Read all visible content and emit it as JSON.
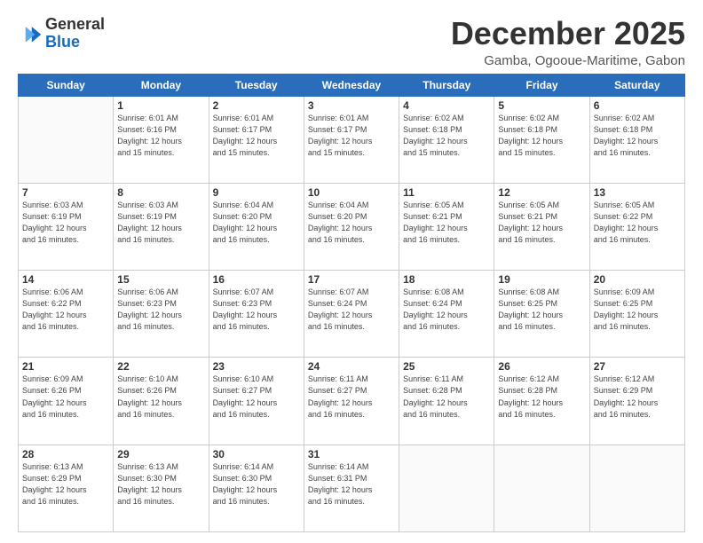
{
  "header": {
    "logo_general": "General",
    "logo_blue": "Blue",
    "title": "December 2025",
    "location": "Gamba, Ogooue-Maritime, Gabon"
  },
  "calendar": {
    "days_of_week": [
      "Sunday",
      "Monday",
      "Tuesday",
      "Wednesday",
      "Thursday",
      "Friday",
      "Saturday"
    ],
    "weeks": [
      [
        {
          "day": "",
          "info": ""
        },
        {
          "day": "1",
          "info": "Sunrise: 6:01 AM\nSunset: 6:16 PM\nDaylight: 12 hours\nand 15 minutes."
        },
        {
          "day": "2",
          "info": "Sunrise: 6:01 AM\nSunset: 6:17 PM\nDaylight: 12 hours\nand 15 minutes."
        },
        {
          "day": "3",
          "info": "Sunrise: 6:01 AM\nSunset: 6:17 PM\nDaylight: 12 hours\nand 15 minutes."
        },
        {
          "day": "4",
          "info": "Sunrise: 6:02 AM\nSunset: 6:18 PM\nDaylight: 12 hours\nand 15 minutes."
        },
        {
          "day": "5",
          "info": "Sunrise: 6:02 AM\nSunset: 6:18 PM\nDaylight: 12 hours\nand 15 minutes."
        },
        {
          "day": "6",
          "info": "Sunrise: 6:02 AM\nSunset: 6:18 PM\nDaylight: 12 hours\nand 16 minutes."
        }
      ],
      [
        {
          "day": "7",
          "info": "Sunrise: 6:03 AM\nSunset: 6:19 PM\nDaylight: 12 hours\nand 16 minutes."
        },
        {
          "day": "8",
          "info": "Sunrise: 6:03 AM\nSunset: 6:19 PM\nDaylight: 12 hours\nand 16 minutes."
        },
        {
          "day": "9",
          "info": "Sunrise: 6:04 AM\nSunset: 6:20 PM\nDaylight: 12 hours\nand 16 minutes."
        },
        {
          "day": "10",
          "info": "Sunrise: 6:04 AM\nSunset: 6:20 PM\nDaylight: 12 hours\nand 16 minutes."
        },
        {
          "day": "11",
          "info": "Sunrise: 6:05 AM\nSunset: 6:21 PM\nDaylight: 12 hours\nand 16 minutes."
        },
        {
          "day": "12",
          "info": "Sunrise: 6:05 AM\nSunset: 6:21 PM\nDaylight: 12 hours\nand 16 minutes."
        },
        {
          "day": "13",
          "info": "Sunrise: 6:05 AM\nSunset: 6:22 PM\nDaylight: 12 hours\nand 16 minutes."
        }
      ],
      [
        {
          "day": "14",
          "info": "Sunrise: 6:06 AM\nSunset: 6:22 PM\nDaylight: 12 hours\nand 16 minutes."
        },
        {
          "day": "15",
          "info": "Sunrise: 6:06 AM\nSunset: 6:23 PM\nDaylight: 12 hours\nand 16 minutes."
        },
        {
          "day": "16",
          "info": "Sunrise: 6:07 AM\nSunset: 6:23 PM\nDaylight: 12 hours\nand 16 minutes."
        },
        {
          "day": "17",
          "info": "Sunrise: 6:07 AM\nSunset: 6:24 PM\nDaylight: 12 hours\nand 16 minutes."
        },
        {
          "day": "18",
          "info": "Sunrise: 6:08 AM\nSunset: 6:24 PM\nDaylight: 12 hours\nand 16 minutes."
        },
        {
          "day": "19",
          "info": "Sunrise: 6:08 AM\nSunset: 6:25 PM\nDaylight: 12 hours\nand 16 minutes."
        },
        {
          "day": "20",
          "info": "Sunrise: 6:09 AM\nSunset: 6:25 PM\nDaylight: 12 hours\nand 16 minutes."
        }
      ],
      [
        {
          "day": "21",
          "info": "Sunrise: 6:09 AM\nSunset: 6:26 PM\nDaylight: 12 hours\nand 16 minutes."
        },
        {
          "day": "22",
          "info": "Sunrise: 6:10 AM\nSunset: 6:26 PM\nDaylight: 12 hours\nand 16 minutes."
        },
        {
          "day": "23",
          "info": "Sunrise: 6:10 AM\nSunset: 6:27 PM\nDaylight: 12 hours\nand 16 minutes."
        },
        {
          "day": "24",
          "info": "Sunrise: 6:11 AM\nSunset: 6:27 PM\nDaylight: 12 hours\nand 16 minutes."
        },
        {
          "day": "25",
          "info": "Sunrise: 6:11 AM\nSunset: 6:28 PM\nDaylight: 12 hours\nand 16 minutes."
        },
        {
          "day": "26",
          "info": "Sunrise: 6:12 AM\nSunset: 6:28 PM\nDaylight: 12 hours\nand 16 minutes."
        },
        {
          "day": "27",
          "info": "Sunrise: 6:12 AM\nSunset: 6:29 PM\nDaylight: 12 hours\nand 16 minutes."
        }
      ],
      [
        {
          "day": "28",
          "info": "Sunrise: 6:13 AM\nSunset: 6:29 PM\nDaylight: 12 hours\nand 16 minutes."
        },
        {
          "day": "29",
          "info": "Sunrise: 6:13 AM\nSunset: 6:30 PM\nDaylight: 12 hours\nand 16 minutes."
        },
        {
          "day": "30",
          "info": "Sunrise: 6:14 AM\nSunset: 6:30 PM\nDaylight: 12 hours\nand 16 minutes."
        },
        {
          "day": "31",
          "info": "Sunrise: 6:14 AM\nSunset: 6:31 PM\nDaylight: 12 hours\nand 16 minutes."
        },
        {
          "day": "",
          "info": ""
        },
        {
          "day": "",
          "info": ""
        },
        {
          "day": "",
          "info": ""
        }
      ]
    ]
  }
}
